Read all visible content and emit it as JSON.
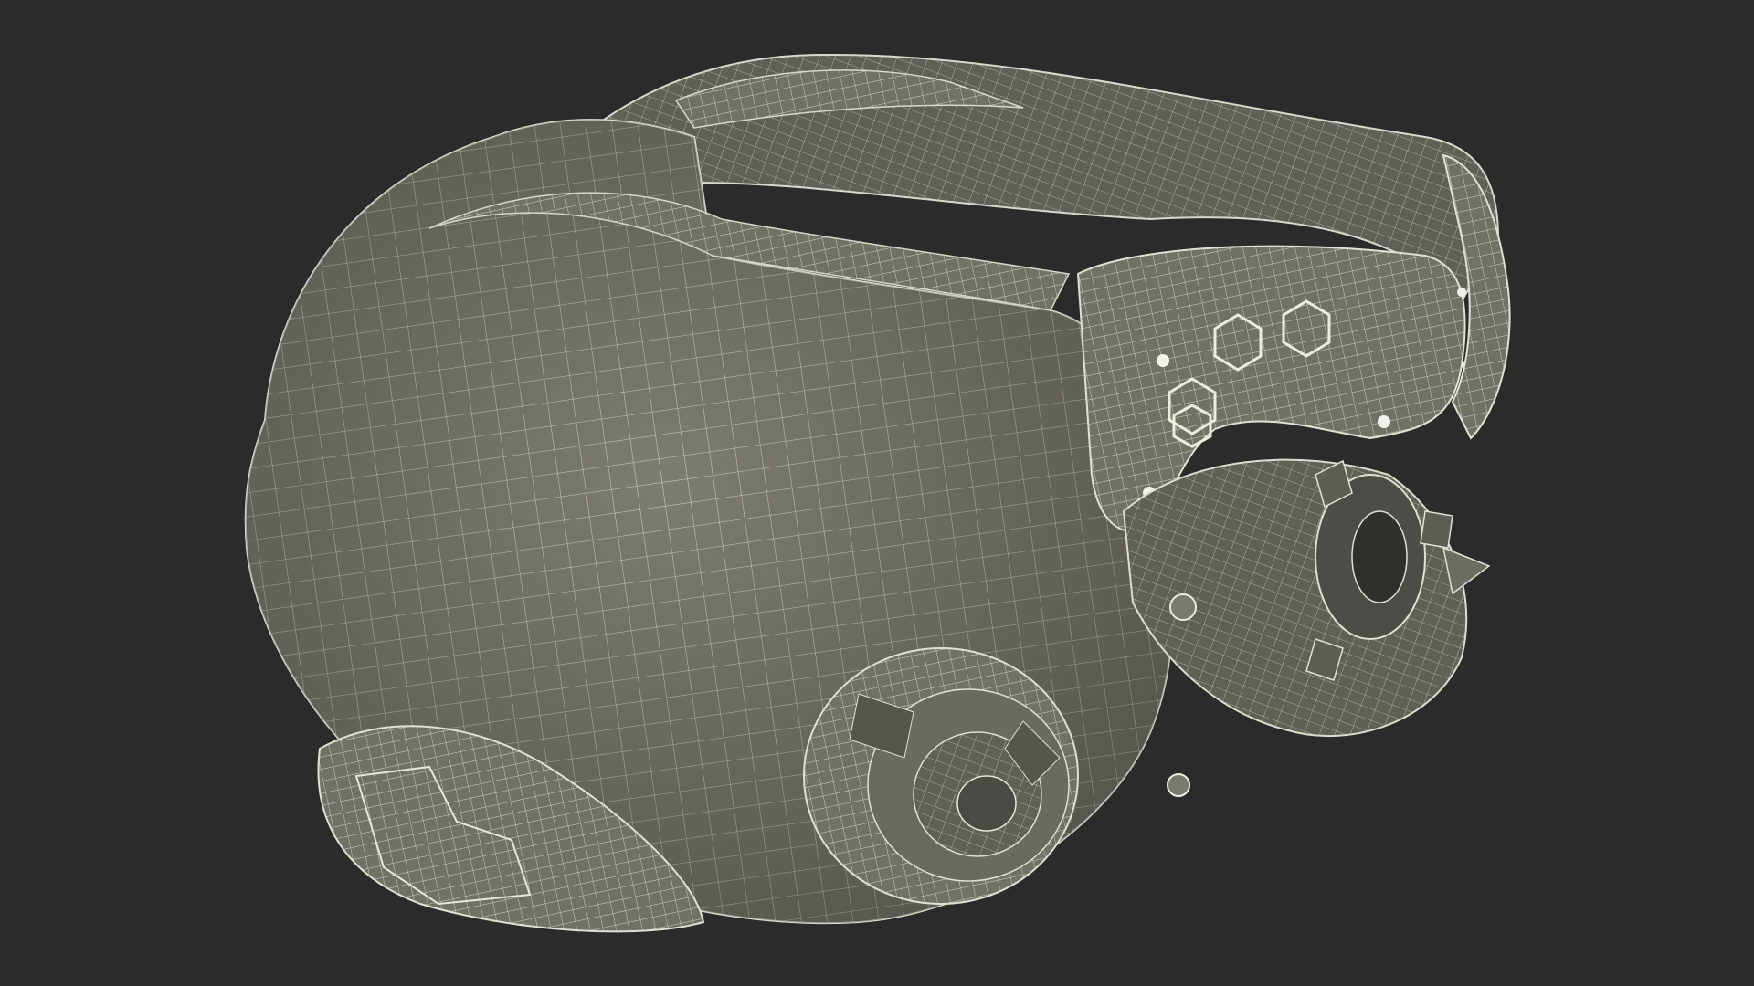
{
  "scene": {
    "subject_icon": "wireframe-mask-icon",
    "colors": {
      "background": "#2b2b2b",
      "surface": "#7e7f72",
      "surface_dark": "#5e5f55",
      "surface_shadow": "#45463f",
      "wire": "#e6e6da",
      "rivet": "#f2f2ec"
    }
  }
}
